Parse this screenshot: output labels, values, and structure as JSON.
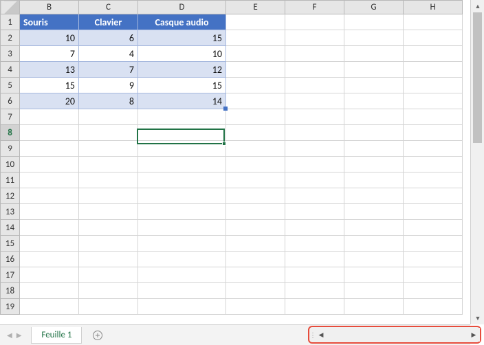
{
  "columns": [
    "B",
    "C",
    "D",
    "E",
    "F",
    "G",
    "H"
  ],
  "rows": [
    "1",
    "2",
    "3",
    "4",
    "5",
    "6",
    "7",
    "8",
    "9",
    "10",
    "11",
    "12",
    "13",
    "14",
    "15",
    "16",
    "17",
    "18",
    "19"
  ],
  "table": {
    "headers": [
      "Souris",
      "Clavier",
      "Casque audio"
    ],
    "data": [
      [
        10,
        6,
        15
      ],
      [
        7,
        4,
        10
      ],
      [
        13,
        7,
        12
      ],
      [
        15,
        9,
        15
      ],
      [
        20,
        8,
        14
      ]
    ]
  },
  "activeRow": "8",
  "sheetTab": "Feuille 1",
  "chart_data": {
    "type": "table",
    "title": "",
    "columns": [
      "Souris",
      "Clavier",
      "Casque audio"
    ],
    "rows_index": [
      2,
      3,
      4,
      5,
      6
    ],
    "values": [
      [
        10,
        6,
        15
      ],
      [
        7,
        4,
        10
      ],
      [
        13,
        7,
        12
      ],
      [
        15,
        9,
        15
      ],
      [
        20,
        8,
        14
      ]
    ]
  }
}
